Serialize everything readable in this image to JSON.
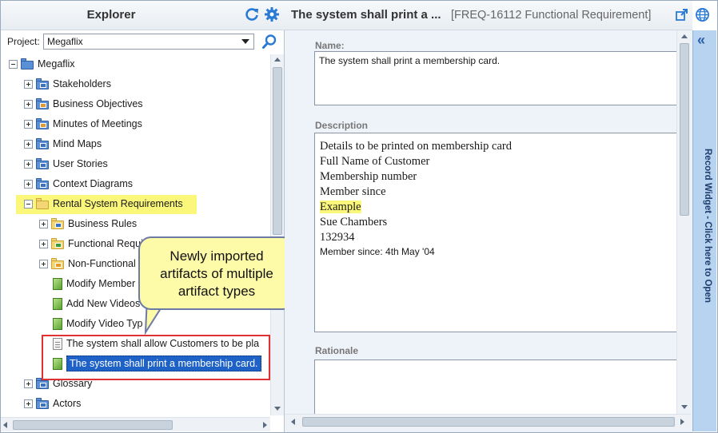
{
  "explorer": {
    "title": "Explorer",
    "project_label": "Project:",
    "project_value": "Megaflix"
  },
  "tree": {
    "root": "Megaflix",
    "items": [
      {
        "label": "Stakeholders"
      },
      {
        "label": "Business Objectives"
      },
      {
        "label": "Minutes of Meetings"
      },
      {
        "label": "Mind Maps"
      },
      {
        "label": "User Stories"
      },
      {
        "label": "Context Diagrams"
      },
      {
        "label": "Rental System Requirements"
      },
      {
        "label": "Business Rules"
      },
      {
        "label": "Functional Requi"
      },
      {
        "label": "Non-Functional"
      },
      {
        "label": "Modify Member"
      },
      {
        "label": "Add New Videos"
      },
      {
        "label": "Modify Video Typ"
      },
      {
        "label": "The system shall allow Customers to be pla"
      },
      {
        "label": "The system shall print a membership card."
      },
      {
        "label": "Glossary"
      },
      {
        "label": "Actors"
      }
    ]
  },
  "callout": {
    "line1": "Newly imported",
    "line2": "artifacts of multiple",
    "line3": "artifact types"
  },
  "record": {
    "title": "The system shall print a ...",
    "subtitle": "[FREQ-16112 Functional Requirement]",
    "name_label": "Name:",
    "name_value": "The system shall print a membership card.",
    "description_label": "Description",
    "description_lines": [
      "Details to be printed on membership card",
      "Full Name of Customer",
      "Membership number",
      "Member since",
      "Example",
      "Sue Chambers",
      "132934",
      "Member since: 4th May '04"
    ],
    "rationale_label": "Rationale"
  },
  "widget": {
    "text": "Record Widget - Click here to Open"
  },
  "colors": {
    "selection": "#1e62c8",
    "highlight": "#fbf77a",
    "accent": "#2a7ad4",
    "callout_bg": "#fdfaa8",
    "red_box": "#e03232"
  }
}
